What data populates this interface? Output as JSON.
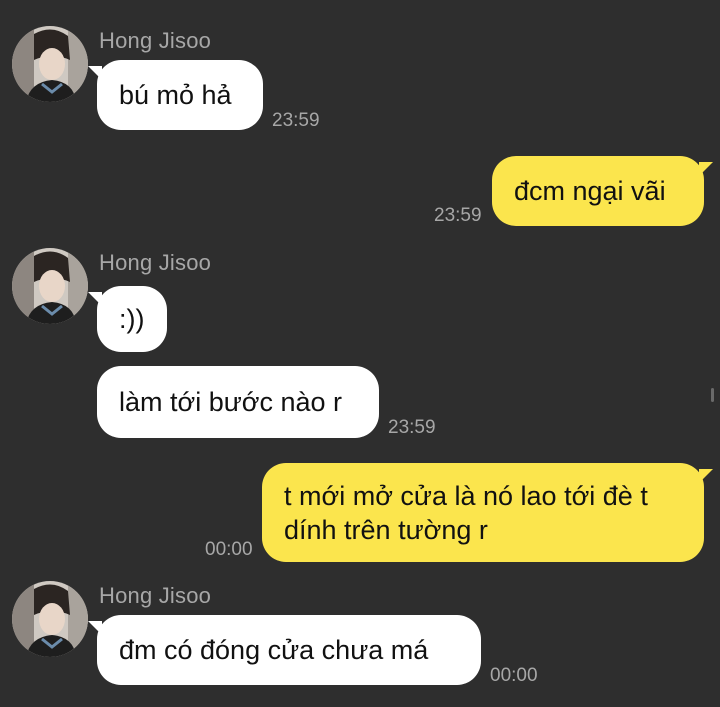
{
  "messages": [
    {
      "sender": "Hong Jisoo",
      "text": "bú mỏ hả",
      "time": "23:59"
    },
    {
      "text": "đcm ngại vãi",
      "time": "23:59"
    },
    {
      "sender": "Hong Jisoo",
      "text": ":))"
    },
    {
      "text": "làm tới bước nào r",
      "time": "23:59"
    },
    {
      "text_line1": "t mới mở cửa là nó lao tới đè t",
      "text_line2": "dính trên tường r",
      "time": "00:00"
    },
    {
      "sender": "Hong Jisoo",
      "text": "đm có đóng cửa chưa má",
      "time": "00:00"
    }
  ],
  "colors": {
    "background": "#2e2e2e",
    "incoming_bubble": "#ffffff",
    "outgoing_bubble": "#fbe54d",
    "meta_text": "#a7a7a7"
  },
  "icons": {
    "avatar": "contact-avatar-photo"
  }
}
